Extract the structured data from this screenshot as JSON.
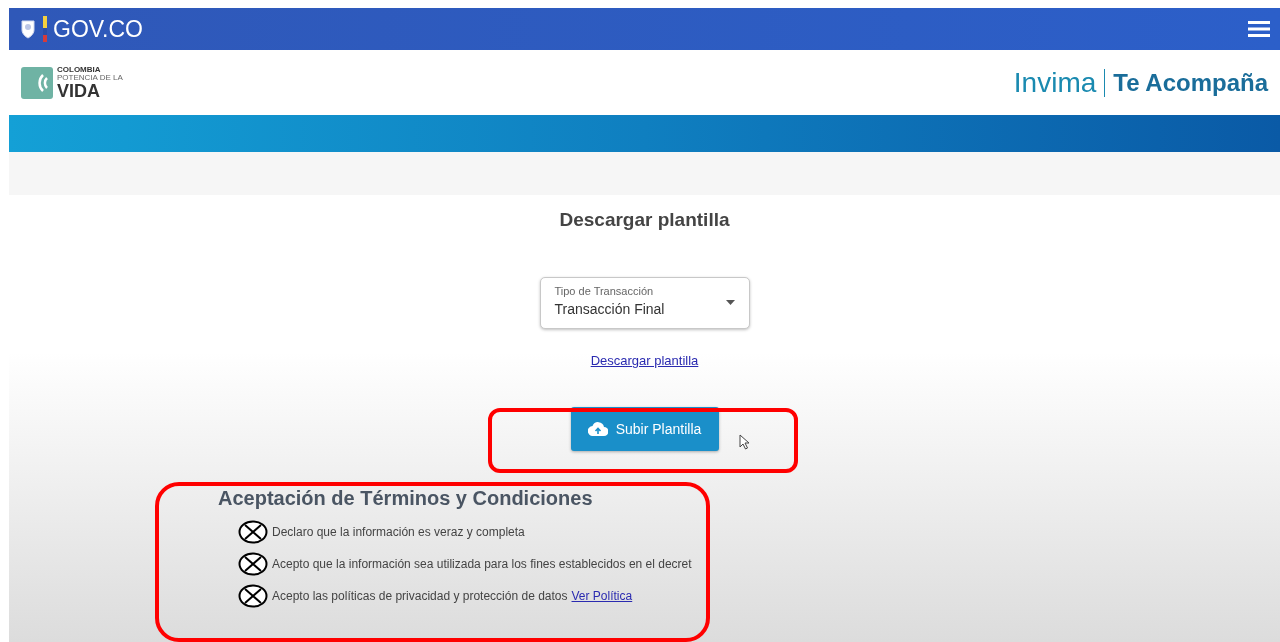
{
  "gov_bar": {
    "brand": "GOV.CO"
  },
  "header": {
    "left_logo": {
      "line1": "COLOMBIA",
      "line2": "POTENCIA DE LA",
      "line3": "VIDA"
    },
    "right_logo": {
      "brand": "Invima",
      "tagline": "Te Acompaña"
    }
  },
  "main": {
    "title": "Descargar plantilla",
    "select": {
      "label": "Tipo de Transacción",
      "value": "Transacción Final"
    },
    "download_link": "Descargar plantilla",
    "upload_button": "Subir Plantilla"
  },
  "terms": {
    "title": "Aceptación de Términos y Condiciones",
    "items": [
      {
        "text": "Declaro que la información es veraz y completa"
      },
      {
        "text": "Acepto que la información sea utilizada para los fines establecidos en el decret"
      },
      {
        "text": "Acepto las políticas de privacidad y protección de datos",
        "link": "Ver Política"
      }
    ]
  }
}
